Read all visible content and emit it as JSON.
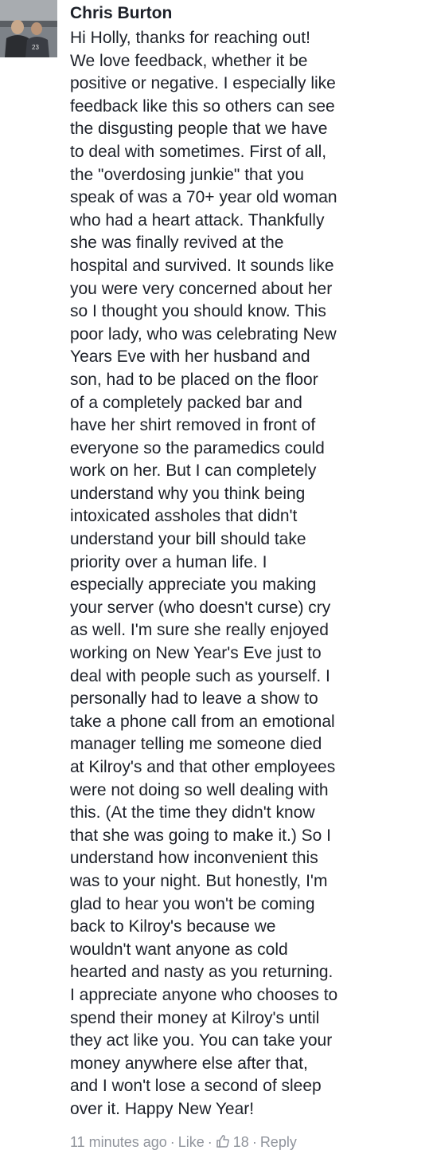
{
  "comment": {
    "author": "Chris Burton",
    "avatar_icon": "profile-photo",
    "lines": [
      "Hi Holly, thanks for reaching out!",
      "We love feedback, whether it be",
      "positive or negative. I especially like",
      "feedback like this so others can see",
      "the disgusting people that we have",
      "to deal with sometimes. First of all,",
      "the \"overdosing junkie\" that you",
      "speak of was a 70+ year old woman",
      "who had a heart attack. Thankfully",
      "she was finally revived at the",
      "hospital and survived. It sounds like",
      "you were very concerned about her",
      "so I thought you should know. This",
      "poor lady, who was celebrating New",
      "Years Eve with her husband and",
      "son, had to be placed on the floor",
      "of a completely packed bar and",
      "have her shirt removed in front of",
      "everyone so the paramedics could",
      "work on her. But I can completely",
      "understand why you think being",
      "intoxicated assholes that didn't",
      "understand your bill should take",
      "priority over a human life. I",
      "especially appreciate you making",
      "your server (who doesn't curse) cry",
      "as well. I'm sure she really enjoyed",
      "working on New Year's Eve just to",
      "deal with people such as yourself. I",
      "personally had to leave a show to",
      "take a phone call from an emotional",
      "manager telling me someone died",
      "at Kilroy's and that other employees",
      "were not doing so well dealing with",
      "this. (At the time they didn't know",
      "that she was going to make it.) So I",
      "understand how inconvenient this",
      "was to your night. But honestly, I'm",
      "glad to hear you won't be coming",
      "back to Kilroy's because we",
      "wouldn't want anyone as cold",
      "hearted and nasty as you returning.",
      "I appreciate anyone who chooses to",
      "spend their money at Kilroy's until",
      "they act like you. You can take your",
      "money anywhere else after that,",
      "and I won't lose a second of sleep",
      "over it. Happy New Year!"
    ],
    "meta": {
      "timestamp": "11 minutes ago",
      "separator": "·",
      "like_label": "Like",
      "like_icon": "thumbs-up-icon",
      "like_count": "18",
      "reply_label": "Reply"
    }
  },
  "colors": {
    "text": "#1d2129",
    "meta": "#90949c",
    "background": "#ffffff"
  }
}
